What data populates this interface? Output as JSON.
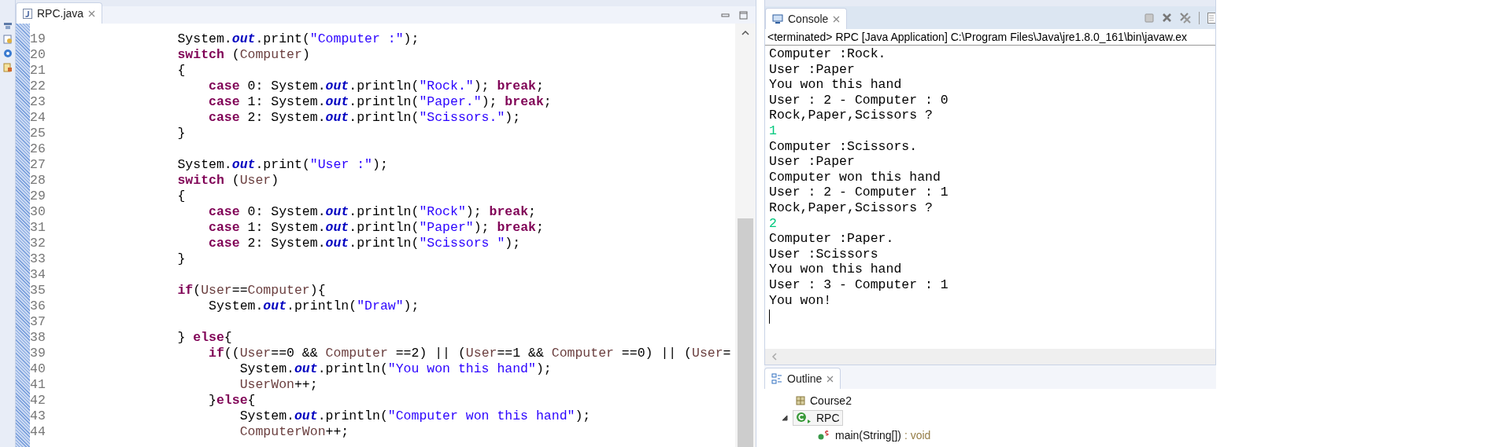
{
  "editor": {
    "tab": {
      "label": "RPC.java",
      "selected": true
    },
    "lines": [
      {
        "number": "19",
        "tokens": [
          {
            "kind": "plain",
            "text": "                System."
          },
          {
            "kind": "field",
            "text": "out"
          },
          {
            "kind": "plain",
            "text": ".print("
          },
          {
            "kind": "str",
            "text": "\"Computer :\""
          },
          {
            "kind": "plain",
            "text": ");"
          }
        ]
      },
      {
        "number": "20",
        "tokens": [
          {
            "kind": "kw",
            "text": "                switch"
          },
          {
            "kind": "plain",
            "text": " ("
          },
          {
            "kind": "var",
            "text": "Computer"
          },
          {
            "kind": "plain",
            "text": ")"
          }
        ]
      },
      {
        "number": "21",
        "tokens": [
          {
            "kind": "plain",
            "text": "                {"
          }
        ]
      },
      {
        "number": "22",
        "tokens": [
          {
            "kind": "kw",
            "text": "                    case"
          },
          {
            "kind": "plain",
            "text": " 0: System."
          },
          {
            "kind": "field",
            "text": "out"
          },
          {
            "kind": "plain",
            "text": ".println("
          },
          {
            "kind": "str",
            "text": "\"Rock.\""
          },
          {
            "kind": "plain",
            "text": "); "
          },
          {
            "kind": "kw",
            "text": "break"
          },
          {
            "kind": "plain",
            "text": ";"
          }
        ]
      },
      {
        "number": "23",
        "tokens": [
          {
            "kind": "kw",
            "text": "                    case"
          },
          {
            "kind": "plain",
            "text": " 1: System."
          },
          {
            "kind": "field",
            "text": "out"
          },
          {
            "kind": "plain",
            "text": ".println("
          },
          {
            "kind": "str",
            "text": "\"Paper.\""
          },
          {
            "kind": "plain",
            "text": "); "
          },
          {
            "kind": "kw",
            "text": "break"
          },
          {
            "kind": "plain",
            "text": ";"
          }
        ]
      },
      {
        "number": "24",
        "tokens": [
          {
            "kind": "kw",
            "text": "                    case"
          },
          {
            "kind": "plain",
            "text": " 2: System."
          },
          {
            "kind": "field",
            "text": "out"
          },
          {
            "kind": "plain",
            "text": ".println("
          },
          {
            "kind": "str",
            "text": "\"Scissors.\""
          },
          {
            "kind": "plain",
            "text": ");"
          }
        ]
      },
      {
        "number": "25",
        "tokens": [
          {
            "kind": "plain",
            "text": "                }"
          }
        ]
      },
      {
        "number": "26"
      },
      {
        "number": "27",
        "tokens": [
          {
            "kind": "plain",
            "text": "                System."
          },
          {
            "kind": "field",
            "text": "out"
          },
          {
            "kind": "plain",
            "text": ".print("
          },
          {
            "kind": "str",
            "text": "\"User :\""
          },
          {
            "kind": "plain",
            "text": ");"
          }
        ]
      },
      {
        "number": "28",
        "tokens": [
          {
            "kind": "kw",
            "text": "                switch"
          },
          {
            "kind": "plain",
            "text": " ("
          },
          {
            "kind": "var",
            "text": "User"
          },
          {
            "kind": "plain",
            "text": ")"
          }
        ]
      },
      {
        "number": "29",
        "tokens": [
          {
            "kind": "plain",
            "text": "                {"
          }
        ]
      },
      {
        "number": "30",
        "tokens": [
          {
            "kind": "kw",
            "text": "                    case"
          },
          {
            "kind": "plain",
            "text": " 0: System."
          },
          {
            "kind": "field",
            "text": "out"
          },
          {
            "kind": "plain",
            "text": ".println("
          },
          {
            "kind": "str",
            "text": "\"Rock\""
          },
          {
            "kind": "plain",
            "text": "); "
          },
          {
            "kind": "kw",
            "text": "break"
          },
          {
            "kind": "plain",
            "text": ";"
          }
        ]
      },
      {
        "number": "31",
        "tokens": [
          {
            "kind": "kw",
            "text": "                    case"
          },
          {
            "kind": "plain",
            "text": " 1: System."
          },
          {
            "kind": "field",
            "text": "out"
          },
          {
            "kind": "plain",
            "text": ".println("
          },
          {
            "kind": "str",
            "text": "\"Paper\""
          },
          {
            "kind": "plain",
            "text": "); "
          },
          {
            "kind": "kw",
            "text": "break"
          },
          {
            "kind": "plain",
            "text": ";"
          }
        ]
      },
      {
        "number": "32",
        "tokens": [
          {
            "kind": "kw",
            "text": "                    case"
          },
          {
            "kind": "plain",
            "text": " 2: System."
          },
          {
            "kind": "field",
            "text": "out"
          },
          {
            "kind": "plain",
            "text": ".println("
          },
          {
            "kind": "str",
            "text": "\"Scissors \""
          },
          {
            "kind": "plain",
            "text": ");"
          }
        ]
      },
      {
        "number": "33",
        "tokens": [
          {
            "kind": "plain",
            "text": "                }"
          }
        ]
      },
      {
        "number": "34"
      },
      {
        "number": "35",
        "tokens": [
          {
            "kind": "kw",
            "text": "                if"
          },
          {
            "kind": "plain",
            "text": "("
          },
          {
            "kind": "var",
            "text": "User"
          },
          {
            "kind": "plain",
            "text": "=="
          },
          {
            "kind": "var",
            "text": "Computer"
          },
          {
            "kind": "plain",
            "text": "){"
          }
        ]
      },
      {
        "number": "36",
        "tokens": [
          {
            "kind": "plain",
            "text": "                    System."
          },
          {
            "kind": "field",
            "text": "out"
          },
          {
            "kind": "plain",
            "text": ".println("
          },
          {
            "kind": "str",
            "text": "\"Draw\""
          },
          {
            "kind": "plain",
            "text": ");"
          }
        ]
      },
      {
        "number": "37"
      },
      {
        "number": "38",
        "tokens": [
          {
            "kind": "plain",
            "text": "                } "
          },
          {
            "kind": "kw",
            "text": "else"
          },
          {
            "kind": "plain",
            "text": "{"
          }
        ]
      },
      {
        "number": "39",
        "tokens": [
          {
            "kind": "kw",
            "text": "                    if"
          },
          {
            "kind": "plain",
            "text": "(("
          },
          {
            "kind": "var",
            "text": "User"
          },
          {
            "kind": "plain",
            "text": "==0 && "
          },
          {
            "kind": "var",
            "text": "Computer"
          },
          {
            "kind": "plain",
            "text": " ==2) || ("
          },
          {
            "kind": "var",
            "text": "User"
          },
          {
            "kind": "plain",
            "text": "==1 && "
          },
          {
            "kind": "var",
            "text": "Computer"
          },
          {
            "kind": "plain",
            "text": " ==0) || ("
          },
          {
            "kind": "var",
            "text": "User"
          },
          {
            "kind": "plain",
            "text": "="
          }
        ]
      },
      {
        "number": "40",
        "tokens": [
          {
            "kind": "plain",
            "text": "                        System."
          },
          {
            "kind": "field",
            "text": "out"
          },
          {
            "kind": "plain",
            "text": ".println("
          },
          {
            "kind": "str",
            "text": "\"You won this hand\""
          },
          {
            "kind": "plain",
            "text": ");"
          }
        ]
      },
      {
        "number": "41",
        "tokens": [
          {
            "kind": "var",
            "text": "                        UserWon"
          },
          {
            "kind": "plain",
            "text": "++;"
          }
        ]
      },
      {
        "number": "42",
        "tokens": [
          {
            "kind": "plain",
            "text": "                    }"
          },
          {
            "kind": "kw",
            "text": "else"
          },
          {
            "kind": "plain",
            "text": "{"
          }
        ]
      },
      {
        "number": "43",
        "tokens": [
          {
            "kind": "plain",
            "text": "                        System."
          },
          {
            "kind": "field",
            "text": "out"
          },
          {
            "kind": "plain",
            "text": ".println("
          },
          {
            "kind": "str",
            "text": "\"Computer won this hand\""
          },
          {
            "kind": "plain",
            "text": ");"
          }
        ]
      },
      {
        "number": "44",
        "tokens": [
          {
            "kind": "var",
            "text": "                        ComputerWon"
          },
          {
            "kind": "plain",
            "text": "++;"
          }
        ]
      }
    ]
  },
  "console": {
    "tab": {
      "label": "Console",
      "selected": true
    },
    "status": "<terminated> RPC [Java Application] C:\\Program Files\\Java\\jre1.8.0_161\\bin\\javaw.ex",
    "lines": [
      {
        "kind": "output",
        "text": "Computer :Rock."
      },
      {
        "kind": "output",
        "text": "User :Paper"
      },
      {
        "kind": "output",
        "text": "You won this hand"
      },
      {
        "kind": "output",
        "text": "User : 2 - Computer : 0"
      },
      {
        "kind": "output",
        "text": "Rock,Paper,Scissors ?"
      },
      {
        "kind": "input",
        "text": "1"
      },
      {
        "kind": "output",
        "text": "Computer :Scissors."
      },
      {
        "kind": "output",
        "text": "User :Paper"
      },
      {
        "kind": "output",
        "text": "Computer won this hand"
      },
      {
        "kind": "output",
        "text": "User : 2 - Computer : 1"
      },
      {
        "kind": "output",
        "text": "Rock,Paper,Scissors ?"
      },
      {
        "kind": "input",
        "text": "2"
      },
      {
        "kind": "output",
        "text": "Computer :Paper."
      },
      {
        "kind": "output",
        "text": "User :Scissors"
      },
      {
        "kind": "output",
        "text": "You won this hand"
      },
      {
        "kind": "output",
        "text": "User : 3 - Computer : 1"
      },
      {
        "kind": "output",
        "text": "You won!"
      }
    ]
  },
  "outline": {
    "tab": {
      "label": "Outline",
      "selected": true
    },
    "items": [
      {
        "kind": "import",
        "label": "Course2",
        "selected": false
      },
      {
        "kind": "class",
        "label": "RPC",
        "selected": true,
        "expanded": true,
        "children": [
          {
            "kind": "method",
            "label": "main(String[])",
            "type": " : void",
            "selected": false
          }
        ]
      }
    ]
  }
}
